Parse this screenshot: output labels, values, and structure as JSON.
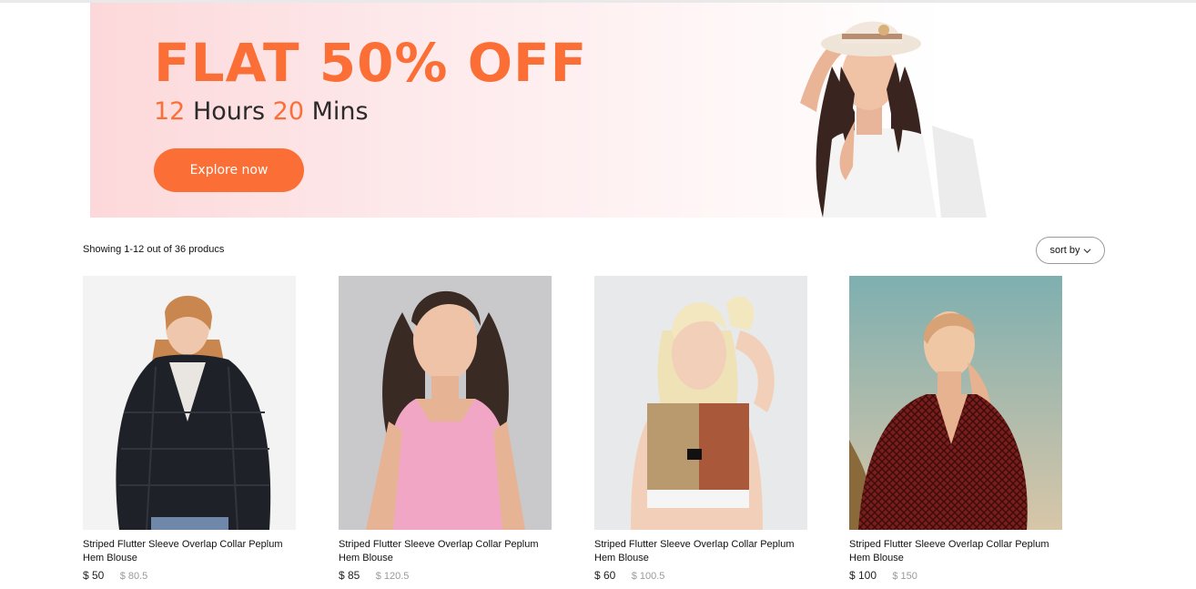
{
  "banner": {
    "headline": "FLAT 50% OFF",
    "countdown": {
      "hours": "12",
      "hours_label": "Hours",
      "mins": "20",
      "mins_label": "Mins"
    },
    "cta_label": "Explore now",
    "accent_color": "#fb6f36"
  },
  "toolbar": {
    "result_text": "Showing 1-12 out of 36 producs",
    "sort_label": "sort by",
    "sort_icon": "chevron-down-icon"
  },
  "products": [
    {
      "name": "Striped Flutter Sleeve Overlap Collar Peplum Hem Blouse",
      "price": "$ 50",
      "old_price": "$ 80.5"
    },
    {
      "name": "Striped Flutter Sleeve Overlap Collar Peplum Hem Blouse",
      "price": "$ 85",
      "old_price": "$ 120.5"
    },
    {
      "name": "Striped Flutter Sleeve Overlap Collar Peplum Hem Blouse",
      "price": "$ 60",
      "old_price": "$ 100.5"
    },
    {
      "name": "Striped Flutter Sleeve Overlap Collar Peplum Hem Blouse",
      "price": "$ 100",
      "old_price": "$ 150"
    }
  ]
}
